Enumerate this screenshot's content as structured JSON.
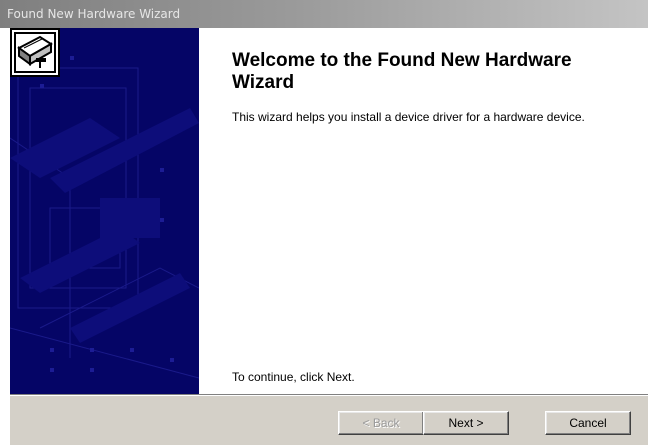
{
  "window": {
    "title": "Found New Hardware Wizard"
  },
  "wizard": {
    "heading": "Welcome to the Found New Hardware Wizard",
    "description": "This wizard helps you install a device driver for a hardware device.",
    "continue_text": "To continue, click Next."
  },
  "buttons": {
    "back_label": "< Back",
    "back_enabled": false,
    "next_label": "Next >",
    "cancel_label": "Cancel"
  },
  "icons": {
    "banner": "hardware-card-icon",
    "panel_art": "circuit-board-watermark"
  },
  "colors": {
    "side_panel": "#050566",
    "footer": "#d4d0c8",
    "title_bar_start": "#7f7f7f",
    "title_bar_end": "#c4c4c4"
  }
}
